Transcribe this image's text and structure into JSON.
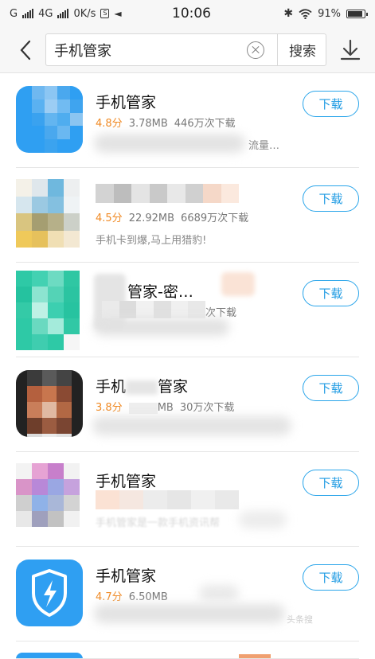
{
  "status_bar": {
    "carrier_left": "G",
    "network": "4G",
    "speed": "0K/s",
    "time": "10:06",
    "battery": "91%",
    "icons": [
      "signal-icon",
      "sim-icon",
      "volume-icon",
      "bluetooth-icon",
      "wifi-icon",
      "battery-icon"
    ]
  },
  "search": {
    "query": "手机管家",
    "submit_label": "搜索",
    "icons": [
      "back-arrow-icon",
      "clear-icon",
      "download-icon"
    ]
  },
  "colors": {
    "accent": "#2aa5ea",
    "rating": "#f08a24",
    "app_blue": "#2f9ff2"
  },
  "results": [
    {
      "name": "手机管家",
      "rating": "4.8分",
      "size": "3.78MB",
      "downloads": "446万次下载",
      "desc": "流量…",
      "button": "下载"
    },
    {
      "name": "",
      "rating": "4.5分",
      "size": "22.92MB",
      "downloads": "6689万次下载",
      "desc": "手机卡到爆,马上用猎豹!",
      "button": "下载"
    },
    {
      "name": "管家-密…",
      "rating": "",
      "size": "",
      "downloads": "次下载",
      "desc": "",
      "button": "下载"
    },
    {
      "name": "手机",
      "name_tail": "管家",
      "rating": "3.8分",
      "size": "MB",
      "downloads": "30万次下载",
      "desc": "",
      "button": "下载"
    },
    {
      "name": "手机管家",
      "rating": "",
      "size": "",
      "downloads": "",
      "desc": "手机管家是一款手机资讯帮",
      "button": "下载"
    },
    {
      "name": "手机管家",
      "rating": "4.7分",
      "size": "6.50MB",
      "downloads": "",
      "desc": "",
      "button": "下载"
    }
  ],
  "watermark": "头条搜"
}
